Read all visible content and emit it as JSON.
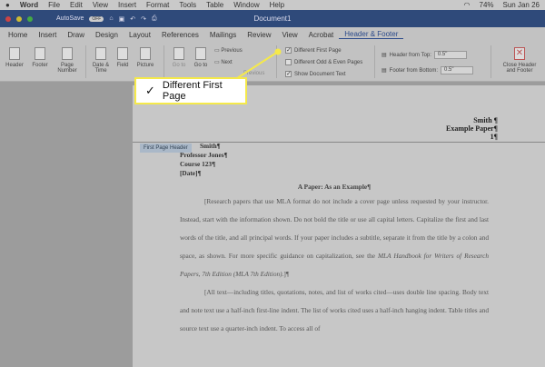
{
  "menubar": {
    "app": "Word",
    "items": [
      "File",
      "Edit",
      "View",
      "Insert",
      "Format",
      "Tools",
      "Table",
      "Window",
      "Help"
    ],
    "battery": "74%",
    "clock": "Sun Jan 26"
  },
  "titlebar": {
    "autosave": "AutoSave",
    "autosave_state": "OFF",
    "title": "Document1"
  },
  "tabs": [
    "Home",
    "Insert",
    "Draw",
    "Design",
    "Layout",
    "References",
    "Mailings",
    "Review",
    "View",
    "Acrobat",
    "Header & Footer"
  ],
  "active_tab": "Header & Footer",
  "ribbon": {
    "header": "Header",
    "footer": "Footer",
    "page_number": "Page Number",
    "date_time": "Date & Time",
    "field": "Field",
    "picture": "Picture",
    "go_to_header": "Go to",
    "go_to_footer": "Go to",
    "previous": "Previous",
    "next": "Next",
    "link_previous": "Previous",
    "different_first_page": "Different First Page",
    "different_first_page_checked": true,
    "different_odd_even": "Different Odd & Even Pages",
    "different_odd_even_checked": false,
    "show_document_text": "Show Document Text",
    "show_document_text_checked": true,
    "header_from_top_label": "Header from Top:",
    "header_from_top": "0.5\"",
    "footer_from_bottom_label": "Footer from Bottom:",
    "footer_from_bottom": "0.5\"",
    "close": "Close Header and Footer"
  },
  "callout": {
    "label": "Different First Page",
    "checked": true,
    "color": "#f5e94a"
  },
  "document": {
    "running_header": [
      "Smith ¶",
      "Example Paper¶",
      "1¶"
    ],
    "header_tag": "First Page Header",
    "heading_lines": [
      "Smith¶",
      "Professor Jones¶",
      "Course 123¶",
      "[Date]¶"
    ],
    "title": "A Paper: As an Example¶",
    "para1": "[Research papers that use MLA format do not include a cover page unless requested by your instructor. Instead, start with the information shown. Do not bold the title or use all capital letters. Capitalize the first and last words of the title, and all principal words. If your paper includes a subtitle, separate it from the title by a colon and space, as shown. For more specific guidance on capitalization, see the ",
    "para1_italic": "MLA Handbook for Writers of Research Papers, 7th Edition (MLA 7th Edition).",
    "para1_end": "]¶",
    "para2": "[All text—including titles, quotations, notes, and list of works cited—uses double line spacing. Body text and note text use a half-inch first-line indent. The list of works cited uses a half-inch hanging indent. Table titles and source text use a quarter-inch indent. To access all of"
  }
}
